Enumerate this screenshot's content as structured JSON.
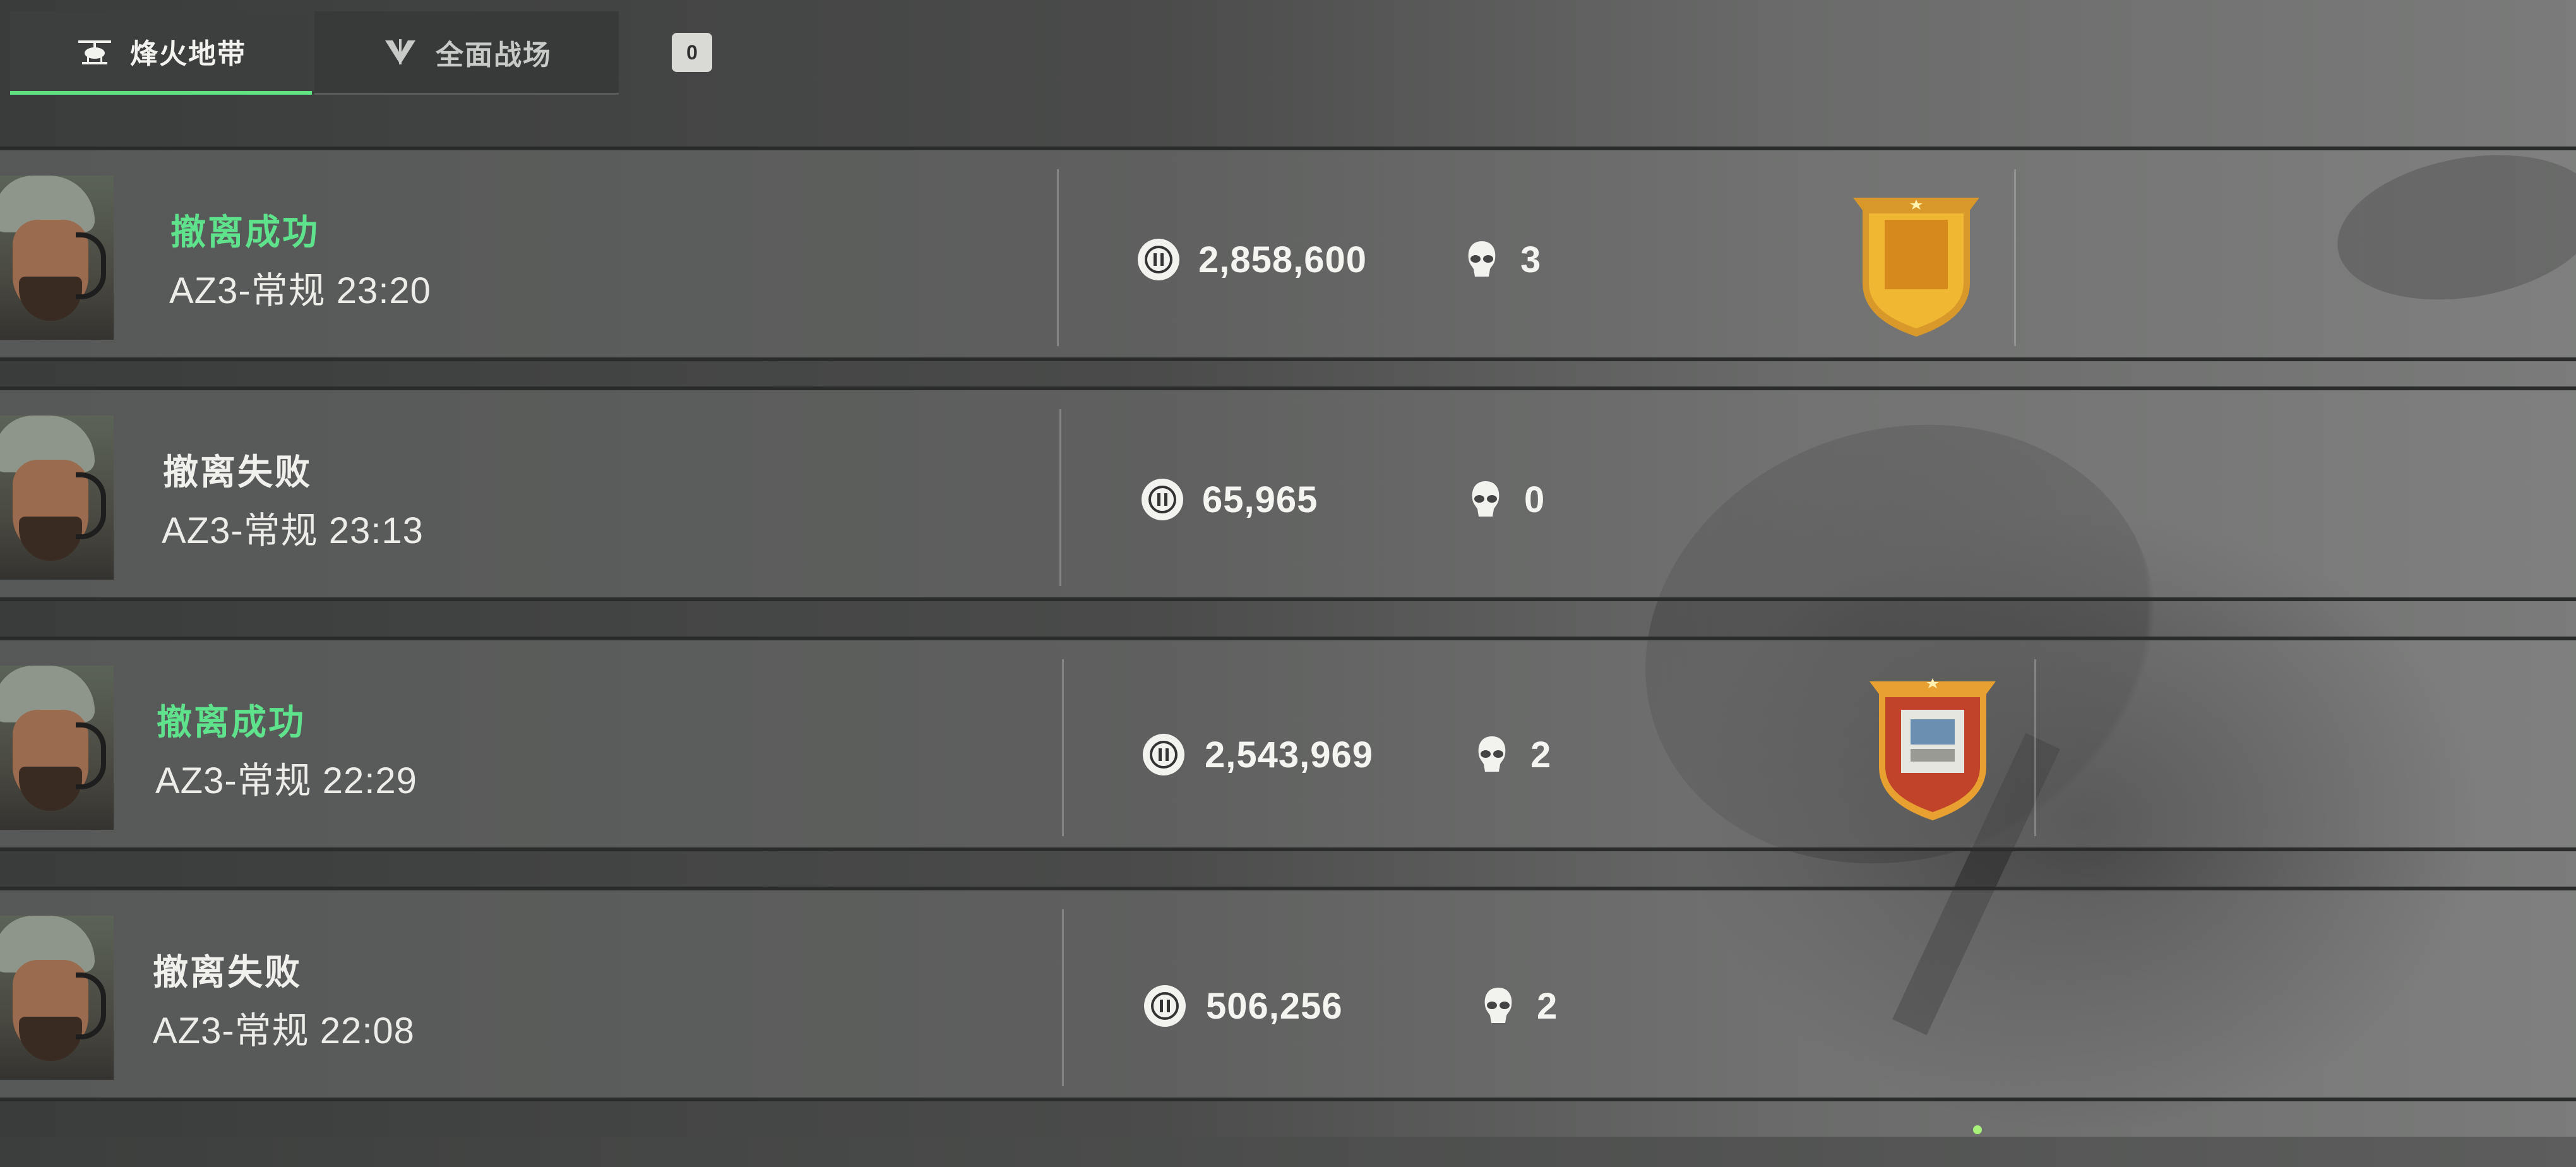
{
  "tabs": {
    "extraction_label": "烽火地带",
    "battlefield_label": "全面战场",
    "badge_count": "0"
  },
  "matches": [
    {
      "status": "撤离成功",
      "status_color": "#5fe28c",
      "mode": "AZ3-常规 23:20",
      "value": "2,858,600",
      "kills": "3",
      "medal": "gold-shield-medal-icon"
    },
    {
      "status": "撤离失败",
      "status_color": "#f0f0ec",
      "mode": "AZ3-常规 23:13",
      "value": "65,965",
      "kills": "0",
      "medal": ""
    },
    {
      "status": "撤离成功",
      "status_color": "#5fe28c",
      "mode": "AZ3-常规 22:29",
      "value": "2,543,969",
      "kills": "2",
      "medal": "red-shield-medal-icon"
    },
    {
      "status": "撤离失败",
      "status_color": "#f0f0ec",
      "mode": "AZ3-常规 22:08",
      "value": "506,256",
      "kills": "2",
      "medal": ""
    }
  ],
  "icons": {
    "coin": "coin-icon",
    "kills": "skull-icon",
    "avatar": "operator-avatar"
  },
  "colors": {
    "accent_green": "#5fe27f",
    "success_text": "#5fe28c"
  }
}
